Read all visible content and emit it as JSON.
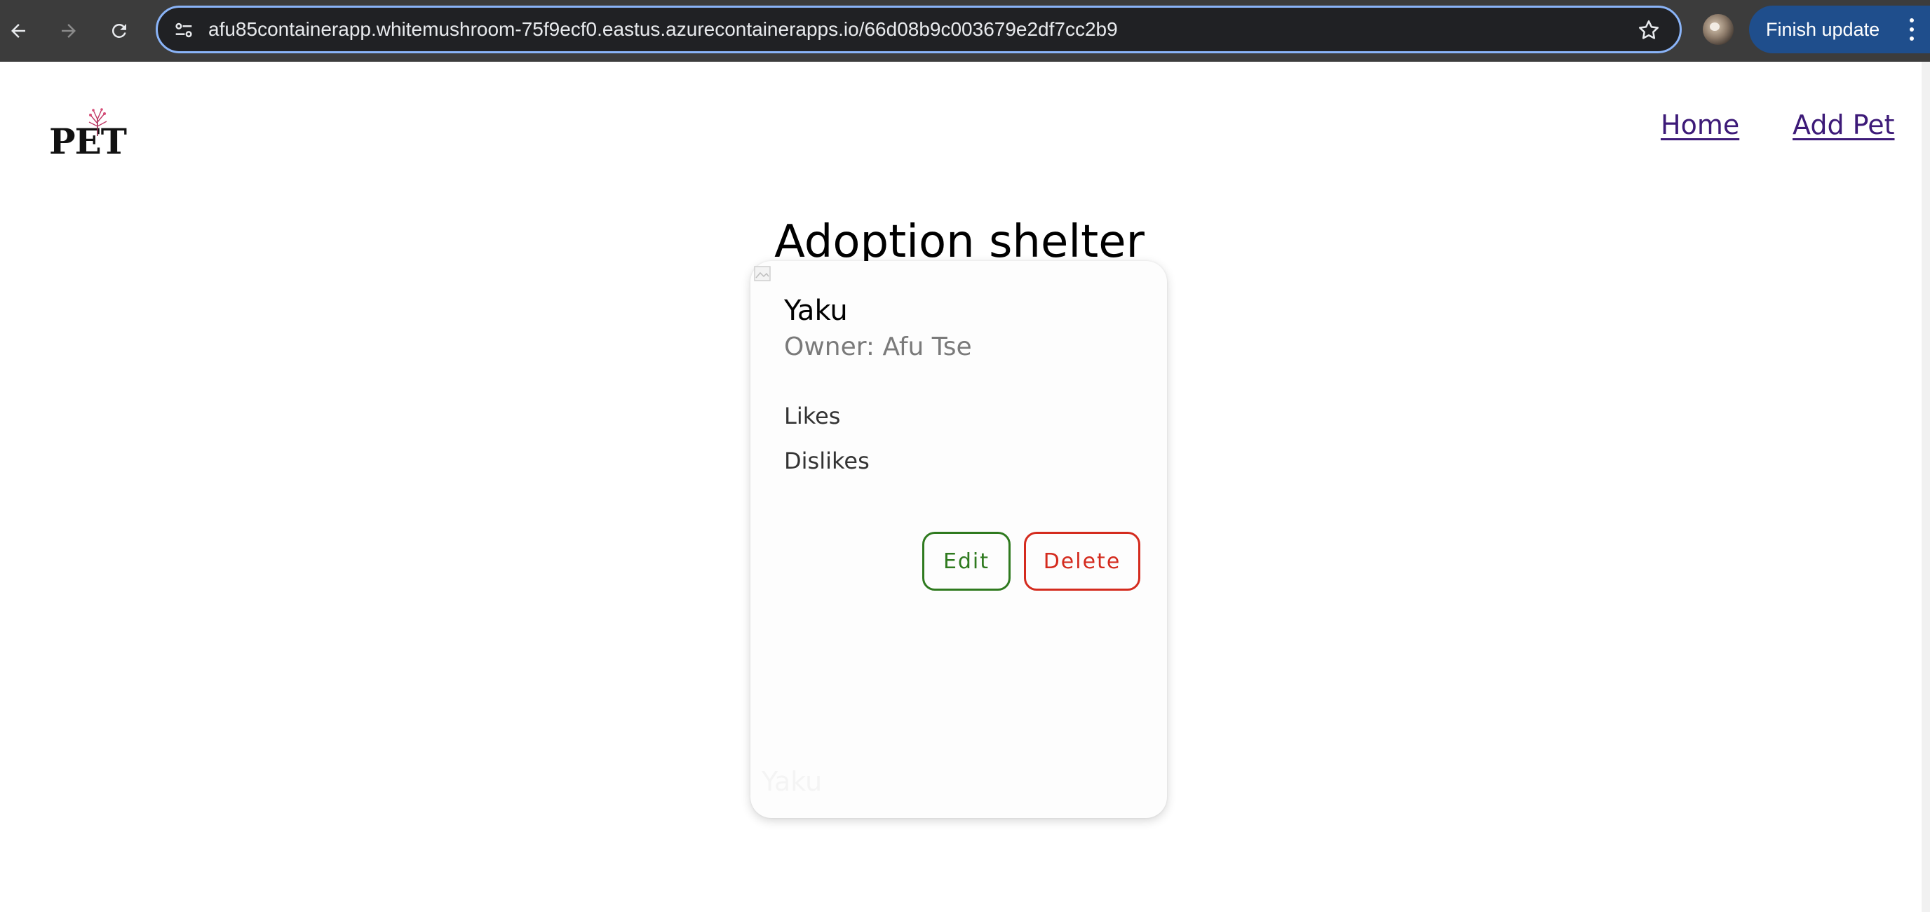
{
  "browser": {
    "url": "afu85containerapp.whitemushroom-75f9ecf0.eastus.azurecontainerapps.io/66d08b9c003679e2df7cc2b9",
    "finish_update_label": "Finish update",
    "icons": {
      "back": "arrow-left-icon",
      "forward": "arrow-right-icon",
      "reload": "reload-icon",
      "site_info": "tune-icon",
      "bookmark": "star-icon",
      "menu": "kebab-menu-icon"
    },
    "colors": {
      "toolbar": "#3c3c3c",
      "omnibox": "#202124",
      "focus_ring": "#8ab4f8",
      "update_button": "#1f4e8c"
    }
  },
  "header": {
    "logo_text": "PET",
    "nav": {
      "home": "Home",
      "add_pet": "Add Pet"
    },
    "link_color": "#3d1a78"
  },
  "main": {
    "title": "Adoption shelter",
    "card": {
      "name": "Yaku",
      "owner": "Owner: Afu Tse",
      "likes": "Likes",
      "dislikes": "Dislikes",
      "image_alt": "Yaku",
      "edit_label": "Edit",
      "delete_label": "Delete",
      "edit_color": "#2f7a1f",
      "delete_color": "#d42b1e"
    }
  }
}
